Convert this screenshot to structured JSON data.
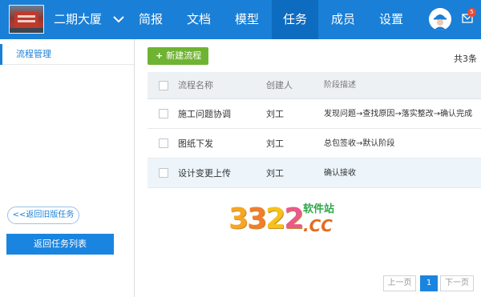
{
  "project": {
    "name": "二期大厦"
  },
  "nav": {
    "items": [
      {
        "label": "简报"
      },
      {
        "label": "文档"
      },
      {
        "label": "模型"
      },
      {
        "label": "任务"
      },
      {
        "label": "成员"
      },
      {
        "label": "设置"
      }
    ],
    "active": "任务",
    "mail_badge": "5"
  },
  "sidebar": {
    "items": [
      {
        "label": "流程管理"
      }
    ],
    "old_tasks_label": "<<返回旧版任务",
    "back_list_label": "返回任务列表"
  },
  "toolbar": {
    "new_label": "新建流程",
    "new_icon": "+",
    "total": "共3条"
  },
  "table": {
    "headers": {
      "name": "流程名称",
      "creator": "创建人",
      "desc": "阶段描述"
    },
    "rows": [
      {
        "name": "施工问题协调",
        "creator": "刘工",
        "desc": "发现问题→查找原因→落实整改→确认完成"
      },
      {
        "name": "图纸下发",
        "creator": "刘工",
        "desc": "总包签收→默认阶段"
      },
      {
        "name": "设计变更上传",
        "creator": "刘工",
        "desc": "确认接收"
      }
    ],
    "highlighted_row": 2
  },
  "pagination": {
    "prev": "上一页",
    "current": "1",
    "next": "下一页"
  },
  "watermark": {
    "digits": [
      "3",
      "3",
      "2",
      "2"
    ],
    "cn": "软件站",
    "domain": ".CC"
  },
  "colors": {
    "primary": "#1a7fd6",
    "nav_active": "#0e6cc0",
    "green": "#6fb332",
    "badge": "#e84b3a"
  }
}
